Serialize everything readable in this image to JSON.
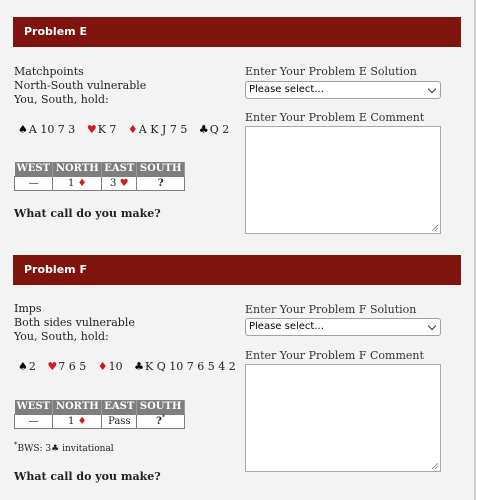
{
  "problem_e": {
    "header": "Problem E",
    "scoring": "Matchpoints",
    "vulnerability": "North-South vulnerable",
    "hold_line": "You, South, hold:",
    "hand": {
      "spades": "A 10 7 3",
      "hearts": "K 7",
      "diamonds": "A K J 7 5",
      "clubs": "Q 2"
    },
    "bidding": {
      "headers": [
        "WEST",
        "NORTH",
        "EAST",
        "SOUTH"
      ],
      "west": "—",
      "north_level": "1",
      "east_level": "3",
      "south": "?"
    },
    "question": "What call do you make?",
    "solution_label": "Enter Your Problem E Solution",
    "select_value": "Please select...",
    "comment_label": "Enter Your Problem E Comment"
  },
  "problem_f": {
    "header": "Problem F",
    "scoring": "Imps",
    "vulnerability": "Both sides vulnerable",
    "hold_line": "You, South, hold:",
    "hand": {
      "spades": "2",
      "hearts": "7 6 5",
      "diamonds": "10",
      "clubs": "K Q 10 7 6 5 4 2"
    },
    "bidding": {
      "headers": [
        "WEST",
        "NORTH",
        "EAST",
        "SOUTH"
      ],
      "west": "—",
      "north_level": "1",
      "east": "Pass",
      "south": "?",
      "south_mark": "*"
    },
    "footnote_mark": "*",
    "footnote_prefix": "BWS: 3",
    "footnote_suffix": "invitational",
    "question": "What call do you make?",
    "solution_label": "Enter Your Problem F Solution",
    "select_value": "Please select...",
    "comment_label": "Enter Your Problem F Comment"
  },
  "suit_symbols": {
    "spade": "♠",
    "heart": "♥",
    "diamond": "♦",
    "club": "♣"
  },
  "colors": {
    "header_bg": "#7f140f",
    "red_suit": "#d21a1a",
    "table_header": "#7e7e7e"
  }
}
